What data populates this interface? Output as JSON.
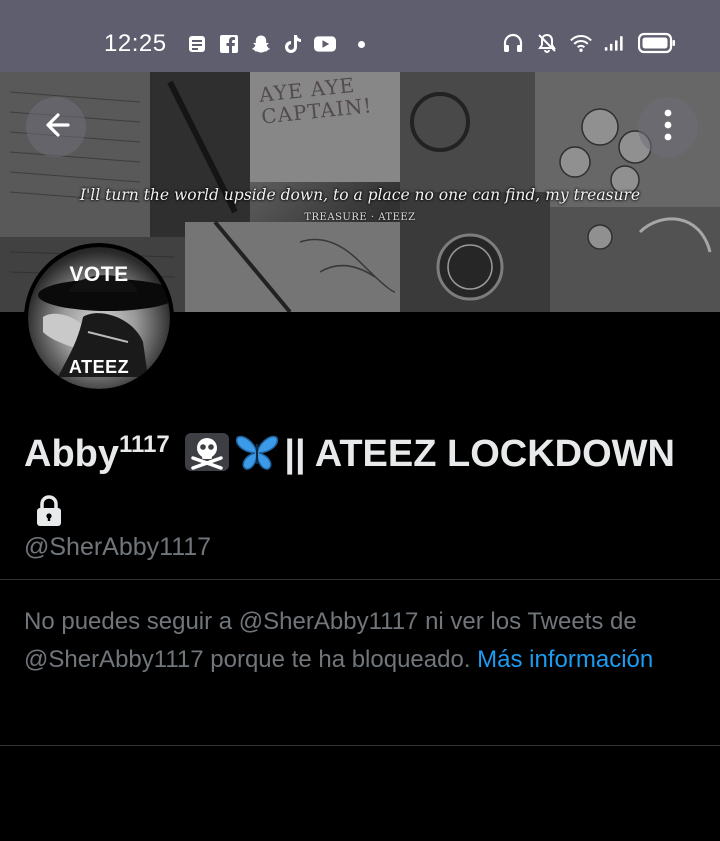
{
  "status_bar": {
    "time": "12:25",
    "left_icons": [
      "notes-icon",
      "facebook-icon",
      "snapchat-icon",
      "tiktok-icon",
      "youtube-icon"
    ],
    "right_icons": [
      "headphones-icon",
      "muted-bell-icon",
      "wifi-icon",
      "signal-icon",
      "battery-icon"
    ]
  },
  "banner": {
    "quote": "I'll turn the world upside down, to a place no one can find, my treasure",
    "credit": "TREASURE · ATEEZ",
    "scrawl": "AYE AYE\nCAPTAIN!"
  },
  "header": {
    "back_icon": "arrow-left-icon",
    "more_icon": "more-vertical-icon"
  },
  "avatar": {
    "top_text": "VOTE",
    "bottom_text": "ATEEZ"
  },
  "profile": {
    "name_main": "Abby",
    "name_sup": "1117",
    "name_emojis": [
      "skull-crossbones-icon",
      "butterfly-icon"
    ],
    "name_rest": "|| ATEEZ LOCKDOWN",
    "lock_icon": "lock-icon",
    "handle": "@SherAbby1117"
  },
  "blocked": {
    "message": "No puedes seguir a @SherAbby1117 ni ver los Tweets de @SherAbby1117 porque te ha bloqueado. ",
    "link": "Más información"
  },
  "colors": {
    "status_bar_bg": "#5f5e6e",
    "background": "#000000",
    "primary_text": "#e7e9ea",
    "secondary_text": "#71767b",
    "link": "#1d9bf0",
    "divider": "#2f3336",
    "butterfly": "#3b9be8"
  }
}
